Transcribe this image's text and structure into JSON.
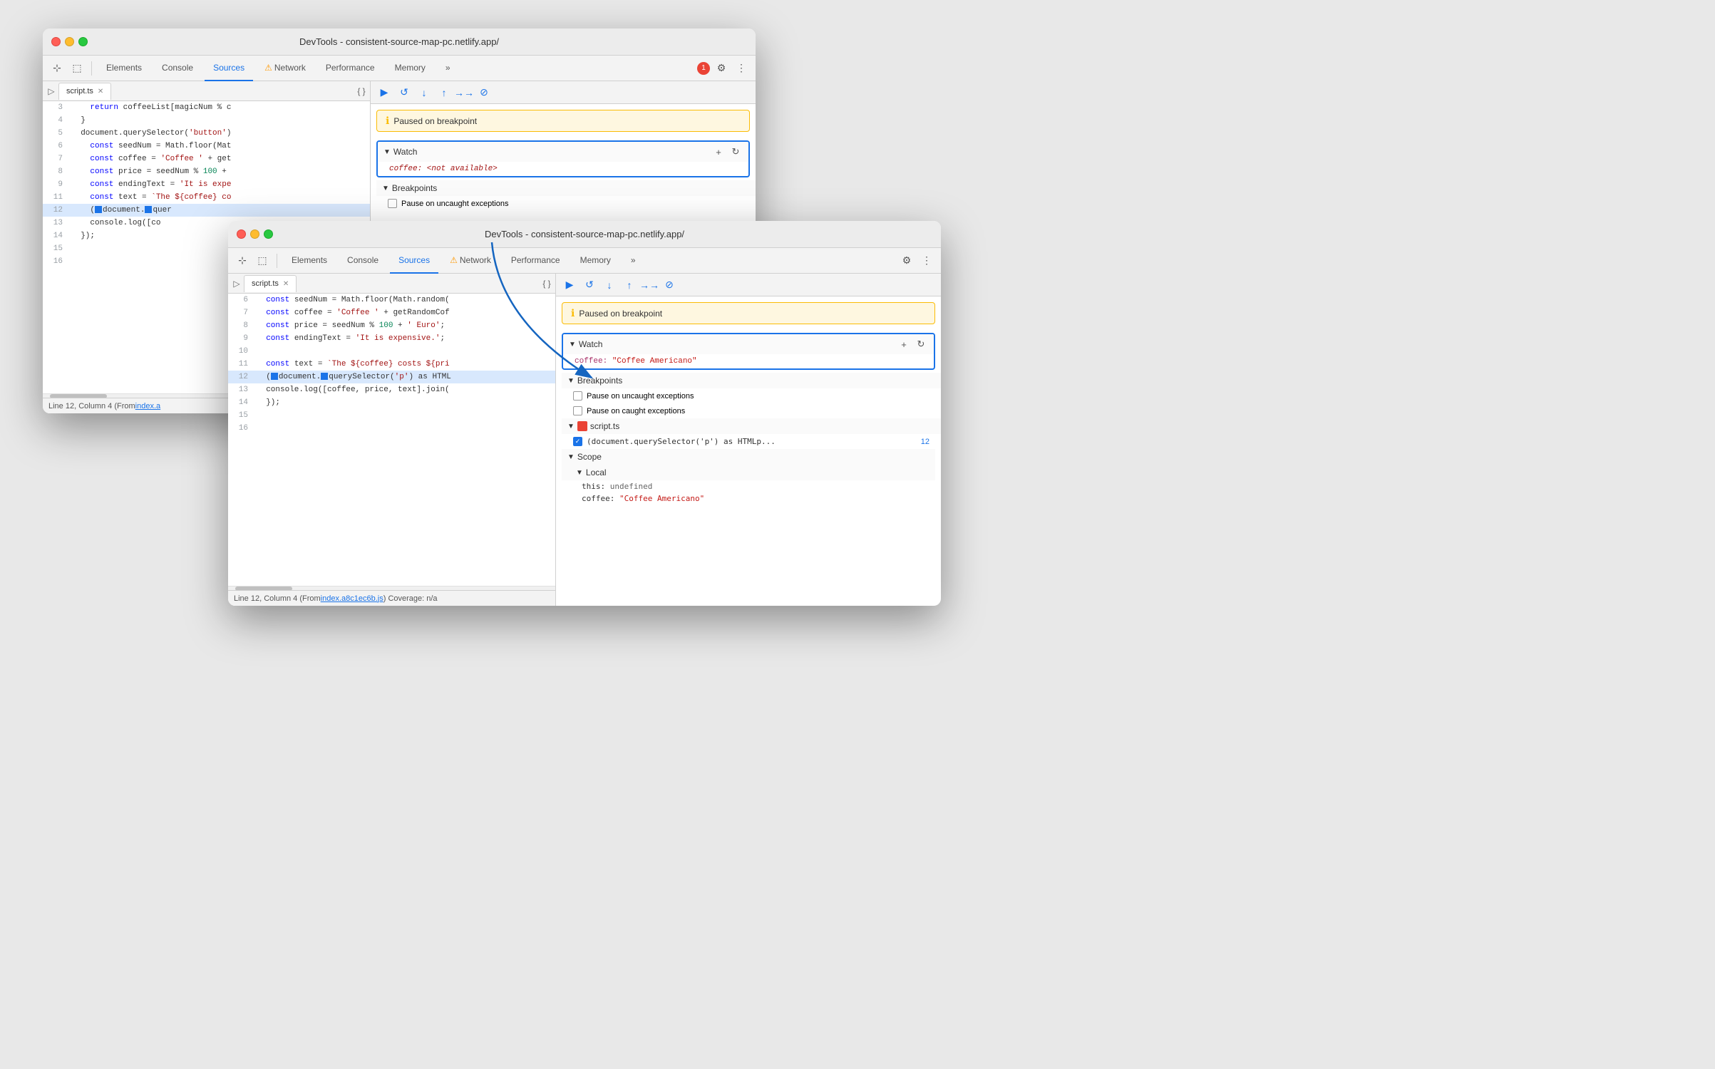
{
  "window_back": {
    "titlebar": {
      "title": "DevTools - consistent-source-map-pc.netlify.app/"
    },
    "tabs": [
      {
        "label": "Elements",
        "active": false
      },
      {
        "label": "Console",
        "active": false
      },
      {
        "label": "Sources",
        "active": true
      },
      {
        "label": "⚠ Network",
        "active": false
      },
      {
        "label": "Performance",
        "active": false
      },
      {
        "label": "Memory",
        "active": false
      },
      {
        "label": "»",
        "active": false
      }
    ],
    "file_tab": "script.ts",
    "code_lines": [
      {
        "num": 3,
        "content": "    return coffeeList[magicNum % c"
      },
      {
        "num": 4,
        "content": "  }"
      },
      {
        "num": 5,
        "content": "  document.querySelector('button')"
      },
      {
        "num": 6,
        "content": "    const seedNum = Math.floor(Mat"
      },
      {
        "num": 7,
        "content": "    const coffee = 'Coffee ' + get"
      },
      {
        "num": 8,
        "content": "    const price = seedNum % 100 + "
      },
      {
        "num": 9,
        "content": "    const endingText = 'It is expe"
      },
      {
        "num": 11,
        "content": "    const text = `The ${coffee} co"
      },
      {
        "num": 12,
        "content": "    (document.querySelector",
        "highlight": true
      },
      {
        "num": 13,
        "content": "    console.log([co"
      },
      {
        "num": 14,
        "content": "  });"
      },
      {
        "num": 15,
        "content": ""
      },
      {
        "num": 16,
        "content": ""
      }
    ],
    "pause_banner": "Paused on breakpoint",
    "watch_label": "Watch",
    "watch_item": "coffee: <not available>",
    "status_bar": "Line 12, Column 4 (From index.a",
    "error_count": "1"
  },
  "window_front": {
    "titlebar": {
      "title": "DevTools - consistent-source-map-pc.netlify.app/"
    },
    "tabs": [
      {
        "label": "Elements",
        "active": false
      },
      {
        "label": "Console",
        "active": false
      },
      {
        "label": "Sources",
        "active": true
      },
      {
        "label": "⚠ Network",
        "active": false
      },
      {
        "label": "Performance",
        "active": false
      },
      {
        "label": "Memory",
        "active": false
      },
      {
        "label": "»",
        "active": false
      }
    ],
    "file_tab": "script.ts",
    "code_lines": [
      {
        "num": 6,
        "content": "  const seedNum = Math.floor(Math.random("
      },
      {
        "num": 7,
        "content": "  const coffee = 'Coffee ' + getRandomCof"
      },
      {
        "num": 8,
        "content": "  const price = seedNum % 100 + ' Euro';"
      },
      {
        "num": 9,
        "content": "  const endingText = 'It is expensive.';"
      },
      {
        "num": 10,
        "content": ""
      },
      {
        "num": 11,
        "content": "  const text = `The ${coffee} costs ${pri"
      },
      {
        "num": 12,
        "content": "  (document.querySelector('p') as HTML",
        "highlight": true
      },
      {
        "num": 13,
        "content": "  console.log([coffee, price, text].join("
      },
      {
        "num": 14,
        "content": "  });"
      },
      {
        "num": 15,
        "content": ""
      },
      {
        "num": 16,
        "content": ""
      }
    ],
    "pause_banner": "Paused on breakpoint",
    "watch_label": "Watch",
    "watch_item_key": "coffee: ",
    "watch_item_value": "\"Coffee Americano\"",
    "breakpoints_label": "Breakpoints",
    "bp_uncaught": "Pause on uncaught exceptions",
    "bp_caught": "Pause on caught exceptions",
    "bp_file": "script.ts",
    "bp_code": "(document.querySelector('p') as HTMLp...",
    "bp_line": "12",
    "scope_label": "Scope",
    "local_label": "Local",
    "scope_this": "this: undefined",
    "scope_coffee_key": "coffee: ",
    "scope_coffee_val": "\"Coffee Americano\"",
    "status_bar": "Line 12, Column 4  (From index.a8c1ec6b.js) Coverage: n/a"
  },
  "arrow": {
    "color": "#1565c0"
  }
}
